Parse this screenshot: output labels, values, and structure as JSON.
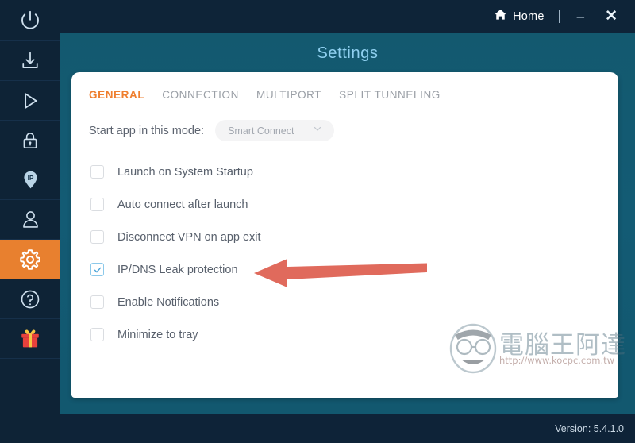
{
  "window": {
    "home_label": "Home",
    "minimize_label": "–",
    "close_label": "✕",
    "page_title": "Settings",
    "version": "Version: 5.4.1.0"
  },
  "sidebar": {
    "items": [
      {
        "icon": "power-icon",
        "name": "power"
      },
      {
        "icon": "download-icon",
        "name": "download"
      },
      {
        "icon": "play-icon",
        "name": "play"
      },
      {
        "icon": "lock-icon",
        "name": "lock"
      },
      {
        "icon": "ip-pin-icon",
        "name": "ip-location"
      },
      {
        "icon": "user-icon",
        "name": "account"
      },
      {
        "icon": "gear-icon",
        "name": "settings"
      },
      {
        "icon": "help-icon",
        "name": "help"
      },
      {
        "icon": "gift-icon",
        "name": "gift"
      }
    ],
    "active_index": 6,
    "active_color": "#e8802f"
  },
  "tabs": [
    {
      "label": "GENERAL",
      "active": true
    },
    {
      "label": "CONNECTION",
      "active": false
    },
    {
      "label": "MULTIPORT",
      "active": false
    },
    {
      "label": "SPLIT TUNNELING",
      "active": false
    }
  ],
  "mode": {
    "label": "Start app in this mode:",
    "value": "Smart Connect"
  },
  "options": [
    {
      "label": "Launch on System Startup",
      "checked": false
    },
    {
      "label": "Auto connect after launch",
      "checked": false
    },
    {
      "label": "Disconnect VPN on app exit",
      "checked": false
    },
    {
      "label": "IP/DNS Leak protection",
      "checked": true
    },
    {
      "label": "Enable Notifications",
      "checked": false
    },
    {
      "label": "Minimize to tray",
      "checked": false
    }
  ],
  "annotation": {
    "type": "arrow",
    "points_to": "IP/DNS Leak protection",
    "color": "#e06a5c"
  },
  "watermark": {
    "text": "電腦王阿達",
    "url": "http://www.kocpc.com.tw"
  },
  "colors": {
    "accent_orange": "#e8802f",
    "titlebar": "#0e2438",
    "body_teal": "#13596f",
    "checkbox_checked": "#8cc9ea",
    "title_text": "#8fd0f0"
  }
}
